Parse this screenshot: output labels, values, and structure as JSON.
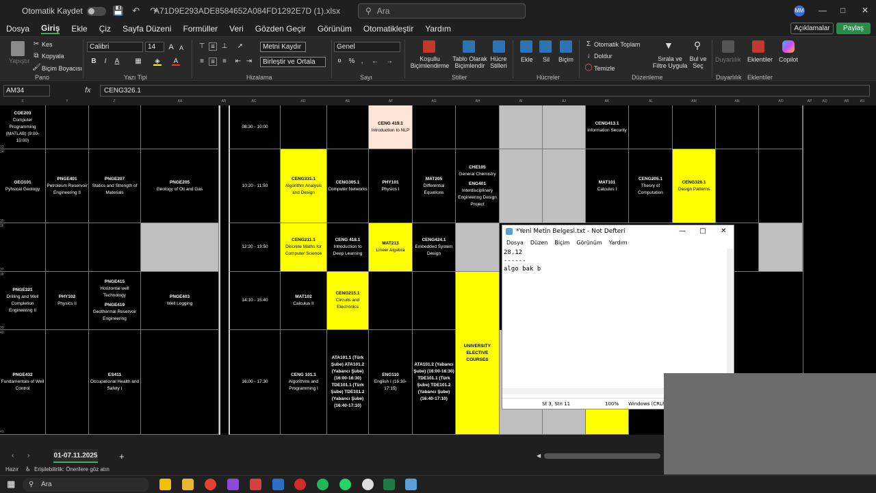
{
  "titlebar": {
    "autosave_label": "Otomatik Kaydet",
    "filename": "A71D9E293ADE8584652A084FD1292E7D (1).xlsx",
    "search_placeholder": "Ara",
    "avatar_initials": "MM"
  },
  "menu": [
    "Dosya",
    "Giriş",
    "Ekle",
    "Çiz",
    "Sayfa Düzeni",
    "Formüller",
    "Veri",
    "Gözden Geçir",
    "Görünüm",
    "Otomatikleştir",
    "Yardım"
  ],
  "menu_active": "Giriş",
  "share": {
    "comments": "Açıklamalar",
    "share": "Paylaş"
  },
  "ribbon": {
    "paste": "Yapıştır",
    "cut": "Kes",
    "copy": "Kopyala",
    "format_painter": "Biçim Boyacısı",
    "group_clipboard": "Pano",
    "font_name": "Calibri",
    "font_size": "14",
    "group_font": "Yazı Tipi",
    "wrap_text": "Metni Kaydır",
    "merge_center": "Birleştir ve Ortala",
    "group_alignment": "Hizalama",
    "number_format": "Genel",
    "group_number": "Sayı",
    "conditional": "Koşullu Biçimlendirme",
    "format_table": "Tablo Olarak Biçimlendir",
    "cell_styles": "Hücre Stilleri",
    "group_styles": "Stiller",
    "insert": "Ekle",
    "delete": "Sil",
    "format": "Biçim",
    "group_cells": "Hücreler",
    "autosum": "Otomatik Toplam",
    "fill": "Doldur",
    "clear": "Temizle",
    "sort_filter": "Sırala ve Filtre Uygula",
    "find_select": "Bul ve Seç",
    "group_editing": "Düzenleme",
    "sensitivity": "Duyarlılık",
    "group_sensitivity": "Duyarlılık",
    "addins": "Eklentiler",
    "group_addins": "Eklentiler",
    "copilot": "Copilot"
  },
  "formula": {
    "namebox": "AM34",
    "fx": "fx",
    "value": "CENG326.1"
  },
  "columns": [
    "X",
    "Y",
    "Z",
    "AA",
    "AB",
    "AC",
    "AD",
    "AE",
    "AF",
    "AG",
    "AH",
    "AI",
    "AJ",
    "AK",
    "AL",
    "AM",
    "AN",
    "AO",
    "AP",
    "AQ",
    "AR",
    "AS"
  ],
  "rows": [
    "33",
    "34",
    "35",
    "36",
    "37",
    "38",
    "39",
    "40",
    "41"
  ],
  "times": [
    "08:30 - 10:00",
    "10:20 - 11:50",
    "12:20 - 13:50",
    "14:10 - 15:40",
    "16:00 - 17:30"
  ],
  "left_table": {
    "r1": [
      {
        "code": "COE203",
        "txt": "Computer Programming (MATLAB) (9:00-10:00)"
      },
      {
        "code": "",
        "txt": ""
      },
      {
        "code": "",
        "txt": ""
      },
      {
        "code": "",
        "txt": ""
      }
    ],
    "r2": [
      {
        "code": "GEO101",
        "txt": "Pyhsical Geology"
      },
      {
        "code": "PNGE401",
        "txt": "Petroleum Reservoir Engineering II"
      },
      {
        "code": "PNGE207",
        "txt": "Statics and Strength of Materials"
      },
      {
        "code": "PNGE205",
        "txt": "Geology of Oil and Gas"
      }
    ],
    "r4": [
      {
        "code": "PNGE321",
        "txt": "Drilling and Well Completion Engineering II"
      },
      {
        "code": "PHY102",
        "txt": "Physics II"
      },
      {
        "code": "PNGE415",
        "txt": "Horizontal well Technology",
        "code2": "PNGE419",
        "txt2": "Geothermal Reservoir Engineering"
      },
      {
        "code": "PNGE403",
        "txt": "Well Logging"
      }
    ],
    "r5": [
      {
        "code": "PNGE432",
        "txt": "Fundamentals of Well Control"
      },
      {
        "code": "",
        "txt": ""
      },
      {
        "code": "ES411",
        "txt": "Occupational Health and Safety I"
      },
      {
        "code": "",
        "txt": ""
      }
    ]
  },
  "right_table": {
    "r1_af": {
      "code": "CENG 419.1",
      "txt": "Introduction to NLP"
    },
    "r1_ak": {
      "code": "CENG413.1",
      "txt": "Information Security"
    },
    "r2_ad": {
      "code": "CENG331.1",
      "txt": "Algorithm Analysis and Design"
    },
    "r2_ae": {
      "code": "CENG305.1",
      "txt": "Computer Networks"
    },
    "r2_af": {
      "code": "PHY101",
      "txt": "Physics I"
    },
    "r2_ag": {
      "code": "MAT205",
      "txt": "Differential Equations"
    },
    "r2_ah": {
      "code": "CHE105",
      "txt": "General Chemistry",
      "code2": "ENG401",
      "txt2": "Interdisciplinary Engineering Design Project"
    },
    "r2_ak": {
      "code": "MAT101",
      "txt": "Calculus I"
    },
    "r2_al": {
      "code": "CENG205.1",
      "txt": "Theory of Computation"
    },
    "r2_am": {
      "code": "CENG326.1",
      "txt": "Design Patterns"
    },
    "r3_ad": {
      "code": "CENG211.1",
      "txt": "Discrete Maths for Computer Science"
    },
    "r3_ae": {
      "code": "CENG 418.1",
      "txt": "Introduction to Deep Learning"
    },
    "r3_af": {
      "code": "MAT213",
      "txt": "Lineer Algebra"
    },
    "r3_ag": {
      "code": "CENG424.1",
      "txt": "Embedded System Design"
    },
    "r4_ad": {
      "code": "MAT102",
      "txt": "Calculus II"
    },
    "r4_ae": {
      "code": "CENG215.1",
      "txt": "Circuits and Electronics"
    },
    "r45_ah": {
      "code": "UNIVERSITY ELECTIVE COURSES",
      "txt": ""
    },
    "r5_ad": {
      "code": "CENG 101.1",
      "txt": "Algorithms and Programming I"
    },
    "r5_ae": {
      "code": "",
      "txt": "ATA101.1 (Türk Şube) ATA101.2 (Yabancı Şube) (16:00-16:30) TDE101.1 (Türk Şube) TDE101.2 (Yabancı Şube) (16:40-17:10)"
    },
    "r5_af": {
      "code": "ENG110",
      "txt": "English I (16:30-17:15)"
    },
    "r5_ag": {
      "code": "",
      "txt": "ATA101.2 (Yabancı Şube) (16:00-16:30) TDE101.1 (Türk Şube) TDE101.2 (Yabancı Şube) (16:40-17:10)"
    }
  },
  "sheet_tab": "01-07.11.2025",
  "status": {
    "ready": "Hazır",
    "accessibility": "Erişilebilirlik: Önerilere göz atın"
  },
  "taskbar": {
    "search": "Ara"
  },
  "notepad": {
    "title": "*Yeni Metin Belgesi.txt - Not Defteri",
    "menu": [
      "Dosya",
      "Düzen",
      "Biçim",
      "Görünüm",
      "Yardım"
    ],
    "content": "28.12\n------\nalgo bak b",
    "position": "St 3, Stn 11",
    "zoom": "100%",
    "encoding": "Windows (CRLF)"
  }
}
